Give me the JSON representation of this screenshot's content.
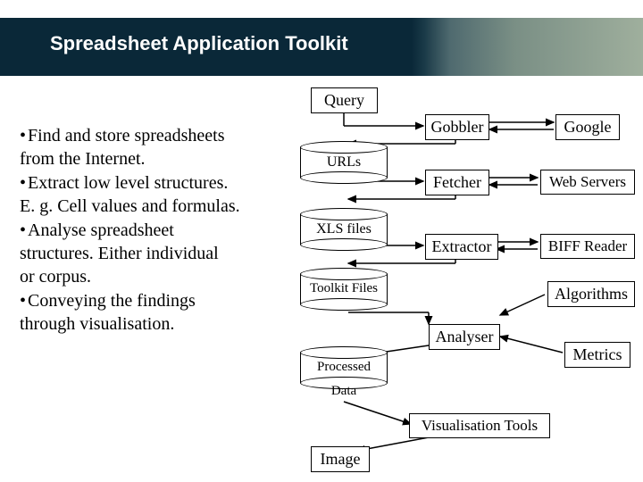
{
  "title": "Spreadsheet Application Toolkit",
  "bullets": [
    {
      "lead": "Find and store spreadsheets",
      "sub": "from the Internet."
    },
    {
      "lead": "Extract low level structures.",
      "sub": "E. g. Cell values and formulas."
    },
    {
      "lead": "Analyse spreadsheet",
      "sub": "structures. Either individual",
      "sub2": "or corpus."
    },
    {
      "lead": "Conveying the findings",
      "sub": "through visualisation."
    }
  ],
  "boxes": {
    "query": "Query",
    "gobbler": "Gobbler",
    "google": "Google",
    "fetcher": "Fetcher",
    "webservers": "Web Servers",
    "extractor": "Extractor",
    "biff": "BIFF Reader",
    "algorithms": "Algorithms",
    "analyser": "Analyser",
    "metrics": "Metrics",
    "vistools": "Visualisation Tools",
    "image": "Image"
  },
  "cyls": {
    "urls": "URLs",
    "xls": "XLS files",
    "toolkit": "Toolkit Files",
    "processed": "Processed",
    "processed_sub": "Data"
  }
}
